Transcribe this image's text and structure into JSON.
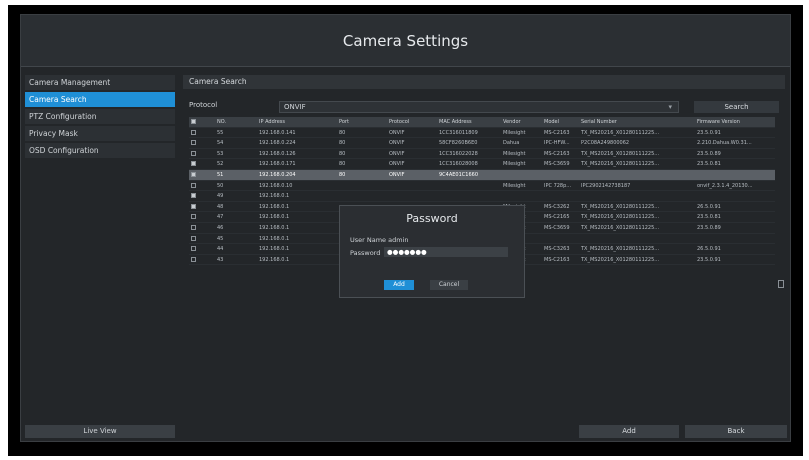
{
  "title": "Camera Settings",
  "sidebar": {
    "items": [
      {
        "label": "Camera Management",
        "active": false
      },
      {
        "label": "Camera Search",
        "active": true
      },
      {
        "label": "PTZ Configuration",
        "active": false
      },
      {
        "label": "Privacy Mask",
        "active": false
      },
      {
        "label": "OSD Configuration",
        "active": false
      }
    ],
    "live_view_label": "Live View"
  },
  "main": {
    "section_title": "Camera Search",
    "protocol_label": "Protocol",
    "protocol_value": "ONVIF",
    "search_label": "Search"
  },
  "table": {
    "headers": [
      "",
      "NO.",
      "IP Address",
      "Port",
      "Protocol",
      "MAC Address",
      "Vendor",
      "Model",
      "Serial Number",
      "Firmware Version"
    ],
    "rows": [
      [
        "",
        "55",
        "192.168.0.141",
        "80",
        "ONVIF",
        "1CC316011809",
        "Milesight",
        "MS-C2163",
        "TX_MS20216_X01280111225...",
        "23.5.0.91"
      ],
      [
        "",
        "54",
        "192.168.0.224",
        "80",
        "ONVIF",
        "58CF8260B6E0",
        "Dahua",
        "IPC-HFW...",
        "P2C08A249800062",
        "2.210.Dahua.W0.31..."
      ],
      [
        "",
        "53",
        "192.168.0.126",
        "80",
        "ONVIF",
        "1CC316022028",
        "Milesight",
        "MS-C2163",
        "TX_MS20216_X01280111225...",
        "23.5.0.89"
      ],
      [
        "",
        "52",
        "192.168.0.171",
        "80",
        "ONVIF",
        "1CC316028008",
        "Milesight",
        "MS-C3659",
        "TX_MS20216_X01280111225...",
        "23.5.0.81"
      ],
      [
        "",
        "51",
        "192.168.0.204",
        "80",
        "ONVIF",
        "9C4AE01C1660",
        "",
        "",
        "",
        ""
      ],
      [
        "",
        "50",
        "192.168.0.10",
        "",
        "",
        "",
        "Milesight",
        "IPC 728p...",
        "IPC2902142738187",
        "onvif_2.3.1.4_20130..."
      ],
      [
        "",
        "49",
        "192.168.0.1",
        "",
        "",
        "",
        "",
        "",
        "",
        ""
      ],
      [
        "",
        "48",
        "192.168.0.1",
        "",
        "",
        "",
        "Milesight",
        "MS-C3262",
        "TX_MS20216_X01280111225...",
        "26.5.0.91"
      ],
      [
        "",
        "47",
        "192.168.0.1",
        "",
        "",
        "",
        "Milesight",
        "MS-C2165",
        "TX_MS20216_X01280111225...",
        "23.5.0.81"
      ],
      [
        "",
        "46",
        "192.168.0.1",
        "",
        "",
        "",
        "Milesight",
        "MS-C3659",
        "TX_MS20216_X01280111225...",
        "23.5.0.89"
      ],
      [
        "",
        "45",
        "192.168.0.1",
        "",
        "",
        "",
        "",
        "",
        "",
        ""
      ],
      [
        "",
        "44",
        "192.168.0.1",
        "",
        "",
        "",
        "Milesight",
        "MS-C3263",
        "TX_MS20216_X01280111225...",
        "26.5.0.91"
      ],
      [
        "",
        "43",
        "192.168.0.1",
        "",
        "",
        "",
        "Milesight",
        "MS-C2163",
        "TX_MS20216_X01280111225...",
        "23.5.0.91"
      ]
    ],
    "checked_rows": [
      3,
      4,
      6,
      7
    ],
    "selected_row": 4
  },
  "dialog": {
    "title": "Password",
    "username_text": "User Name admin",
    "password_label": "Password",
    "password_value": "●●●●●●●",
    "add_label": "Add",
    "cancel_label": "Cancel"
  },
  "footer": {
    "add_label": "Add",
    "back_label": "Back"
  },
  "colors": {
    "accent": "#1f8fd6",
    "background": "#232629"
  }
}
